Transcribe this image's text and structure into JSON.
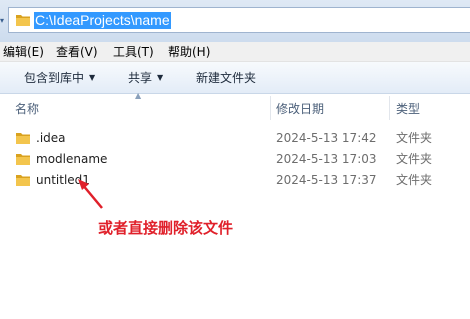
{
  "address": {
    "path": "C:\\IdeaProjects\\name"
  },
  "menu": {
    "items": [
      {
        "label": "编辑(E)"
      },
      {
        "label": "查看(V)"
      },
      {
        "label": "工具(T)"
      },
      {
        "label": "帮助(H)"
      }
    ]
  },
  "toolbar": {
    "include_label": "包含到库中",
    "share_label": "共享",
    "new_folder_label": "新建文件夹"
  },
  "columns": {
    "name": "名称",
    "modified": "修改日期",
    "type": "类型"
  },
  "files": [
    {
      "name": ".idea",
      "modified": "2024-5-13 17:42",
      "type": "文件夹",
      "icon": "folder-icon"
    },
    {
      "name": "modlename",
      "modified": "2024-5-13 17:03",
      "type": "文件夹",
      "icon": "folder-icon"
    },
    {
      "name": "untitled1",
      "modified": "2024-5-13 17:37",
      "type": "文件夹",
      "icon": "folder-icon"
    }
  ],
  "annotation": {
    "text": "或者直接删除该文件",
    "color": "#e0202a"
  },
  "colors": {
    "selection": "#3399ff",
    "folder": "#e8b531",
    "toolbar_bg": "#e3ecf7"
  }
}
